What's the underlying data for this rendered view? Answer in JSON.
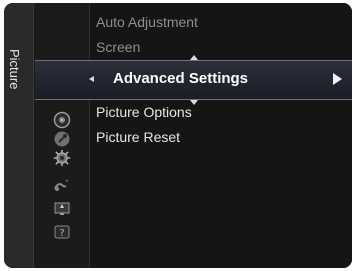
{
  "side_tab": {
    "label": "Picture"
  },
  "menu": {
    "items_above": [
      {
        "label": "Auto Adjustment"
      },
      {
        "label": "Screen"
      }
    ],
    "selected": {
      "label": "Advanced Settings"
    },
    "items_below": [
      {
        "label": "Picture Options"
      },
      {
        "label": "Picture Reset"
      }
    ]
  },
  "icons": [
    "picture-icon",
    "sound-icon",
    "channel-icon",
    "setup-icon",
    "input-icon",
    "application-icon",
    "support-icon"
  ],
  "colors": {
    "background": "#151515",
    "selected_text": "#ffffff",
    "normal_text": "#e6e6e6",
    "dim_text": "#8f8f8f"
  }
}
